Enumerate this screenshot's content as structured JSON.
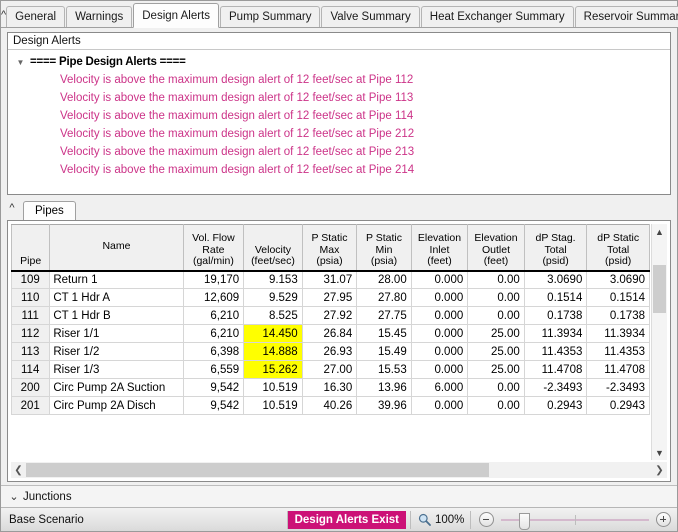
{
  "window": {
    "collapse_icon": "chevron-up"
  },
  "tabs": [
    {
      "label": "General",
      "active": false
    },
    {
      "label": "Warnings",
      "active": false
    },
    {
      "label": "Design Alerts",
      "active": true
    },
    {
      "label": "Pump Summary",
      "active": false
    },
    {
      "label": "Valve Summary",
      "active": false
    },
    {
      "label": "Heat Exchanger Summary",
      "active": false
    },
    {
      "label": "Reservoir Summary",
      "active": false
    }
  ],
  "alerts_panel": {
    "header": "Design Alerts",
    "group_label": "==== Pipe Design Alerts ====",
    "expander_icon": "triangle-down",
    "text_color": "#cc3388",
    "items": [
      "Velocity is above the maximum design alert of 12 feet/sec at Pipe 112",
      "Velocity is above the maximum design alert of 12 feet/sec at Pipe 113",
      "Velocity is above the maximum design alert of 12 feet/sec at Pipe 114",
      "Velocity is above the maximum design alert of 12 feet/sec at Pipe 212",
      "Velocity is above the maximum design alert of 12 feet/sec at Pipe 213",
      "Velocity is above the maximum design alert of 12 feet/sec at Pipe 214"
    ]
  },
  "pipes_section": {
    "collapse_icon": "chevron-up",
    "subtab": "Pipes",
    "columns": [
      {
        "title": "Pipe",
        "units": ""
      },
      {
        "title": "Name",
        "units": ""
      },
      {
        "title": "Vol. Flow Rate",
        "units": "(gal/min)"
      },
      {
        "title": "Velocity",
        "units": "(feet/sec)"
      },
      {
        "title": "P Static Max",
        "units": "(psia)"
      },
      {
        "title": "P Static Min",
        "units": "(psia)"
      },
      {
        "title": "Elevation Inlet",
        "units": "(feet)"
      },
      {
        "title": "Elevation Outlet",
        "units": "(feet)"
      },
      {
        "title": "dP Stag. Total",
        "units": "(psid)"
      },
      {
        "title": "dP Static Total",
        "units": "(psid)"
      }
    ],
    "highlight_color": "#ffff00",
    "rows": [
      {
        "pipe": "109",
        "name": "Return 1",
        "flow": "19,170",
        "velocity": "9.153",
        "velocity_hl": false,
        "pmax": "31.07",
        "pmin": "28.00",
        "elev_in": "0.000",
        "elev_out": "0.00",
        "dp_stag": "3.0690",
        "dp_static": "3.0690"
      },
      {
        "pipe": "110",
        "name": "CT 1 Hdr A",
        "flow": "12,609",
        "velocity": "9.529",
        "velocity_hl": false,
        "pmax": "27.95",
        "pmin": "27.80",
        "elev_in": "0.000",
        "elev_out": "0.00",
        "dp_stag": "0.1514",
        "dp_static": "0.1514"
      },
      {
        "pipe": "111",
        "name": "CT 1 Hdr B",
        "flow": "6,210",
        "velocity": "8.525",
        "velocity_hl": false,
        "pmax": "27.92",
        "pmin": "27.75",
        "elev_in": "0.000",
        "elev_out": "0.00",
        "dp_stag": "0.1738",
        "dp_static": "0.1738"
      },
      {
        "pipe": "112",
        "name": "Riser 1/1",
        "flow": "6,210",
        "velocity": "14.450",
        "velocity_hl": true,
        "pmax": "26.84",
        "pmin": "15.45",
        "elev_in": "0.000",
        "elev_out": "25.00",
        "dp_stag": "11.3934",
        "dp_static": "11.3934"
      },
      {
        "pipe": "113",
        "name": "Riser 1/2",
        "flow": "6,398",
        "velocity": "14.888",
        "velocity_hl": true,
        "pmax": "26.93",
        "pmin": "15.49",
        "elev_in": "0.000",
        "elev_out": "25.00",
        "dp_stag": "11.4353",
        "dp_static": "11.4353"
      },
      {
        "pipe": "114",
        "name": "Riser 1/3",
        "flow": "6,559",
        "velocity": "15.262",
        "velocity_hl": true,
        "pmax": "27.00",
        "pmin": "15.53",
        "elev_in": "0.000",
        "elev_out": "25.00",
        "dp_stag": "11.4708",
        "dp_static": "11.4708"
      },
      {
        "pipe": "200",
        "name": "Circ Pump 2A Suction",
        "flow": "9,542",
        "velocity": "10.519",
        "velocity_hl": false,
        "pmax": "16.30",
        "pmin": "13.96",
        "elev_in": "6.000",
        "elev_out": "0.00",
        "dp_stag": "-2.3493",
        "dp_static": "-2.3493"
      },
      {
        "pipe": "201",
        "name": "Circ Pump 2A Disch",
        "flow": "9,542",
        "velocity": "10.519",
        "velocity_hl": false,
        "pmax": "40.26",
        "pmin": "39.96",
        "elev_in": "0.000",
        "elev_out": "0.00",
        "dp_stag": "0.2943",
        "dp_static": "0.2943"
      }
    ],
    "vscroll": {
      "up_icon": "chevron-up",
      "down_icon": "chevron-down"
    },
    "hscroll": {
      "left_icon": "chevron-left",
      "right_icon": "chevron-right"
    }
  },
  "junctions_bar": {
    "label": "Junctions",
    "expand_icon": "chevron-down"
  },
  "statusbar": {
    "scenario": "Base Scenario",
    "alerts_badge": "Design Alerts Exist",
    "alerts_badge_color": "#cc1177",
    "zoom_icon": "magnifier-icon",
    "zoom_level": "100%",
    "zoom_out_label": "−",
    "zoom_in_label": "+"
  }
}
